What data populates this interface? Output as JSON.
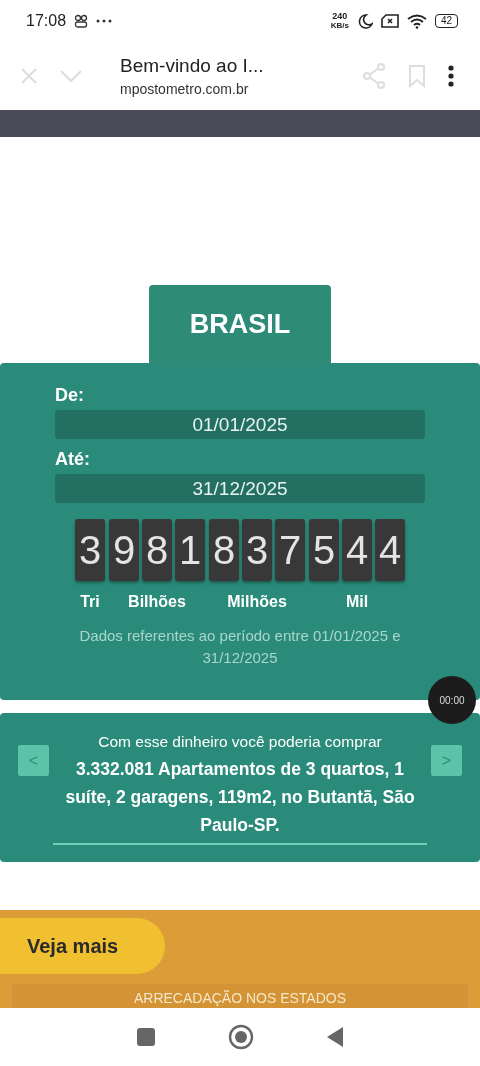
{
  "status_bar": {
    "time": "17:08",
    "net_speed": "240",
    "net_unit": "KB/s",
    "battery": "42"
  },
  "browser": {
    "title": "Bem-vindo ao I...",
    "url": "mpostometro.com.br"
  },
  "region_tab": {
    "label": "BRASIL"
  },
  "period": {
    "from_label": "De:",
    "from_value": "01/01/2025",
    "to_label": "Até:",
    "to_value": "31/12/2025"
  },
  "counter": {
    "groups": [
      {
        "digits": "3",
        "label": "Tri"
      },
      {
        "digits": "981",
        "label": "Bilhões"
      },
      {
        "digits": "837",
        "label": "Milhões"
      },
      {
        "digits": "544",
        "label": "Mil"
      }
    ],
    "note": "Dados referentes ao período entre 01/01/2025 e 31/12/2025"
  },
  "timer_badge": "00:00",
  "carousel": {
    "intro": "Com esse dinheiro você poderia comprar",
    "highlight": "3.332.081 Apartamentos de 3 quartos, 1 suíte, 2 garagens, 119m2, no Butantã, São Paulo-SP.",
    "prev": "<",
    "next": ">"
  },
  "more_section": {
    "button": "Veja mais",
    "heading": "ARRECADAÇÃO NOS ESTADOS"
  }
}
